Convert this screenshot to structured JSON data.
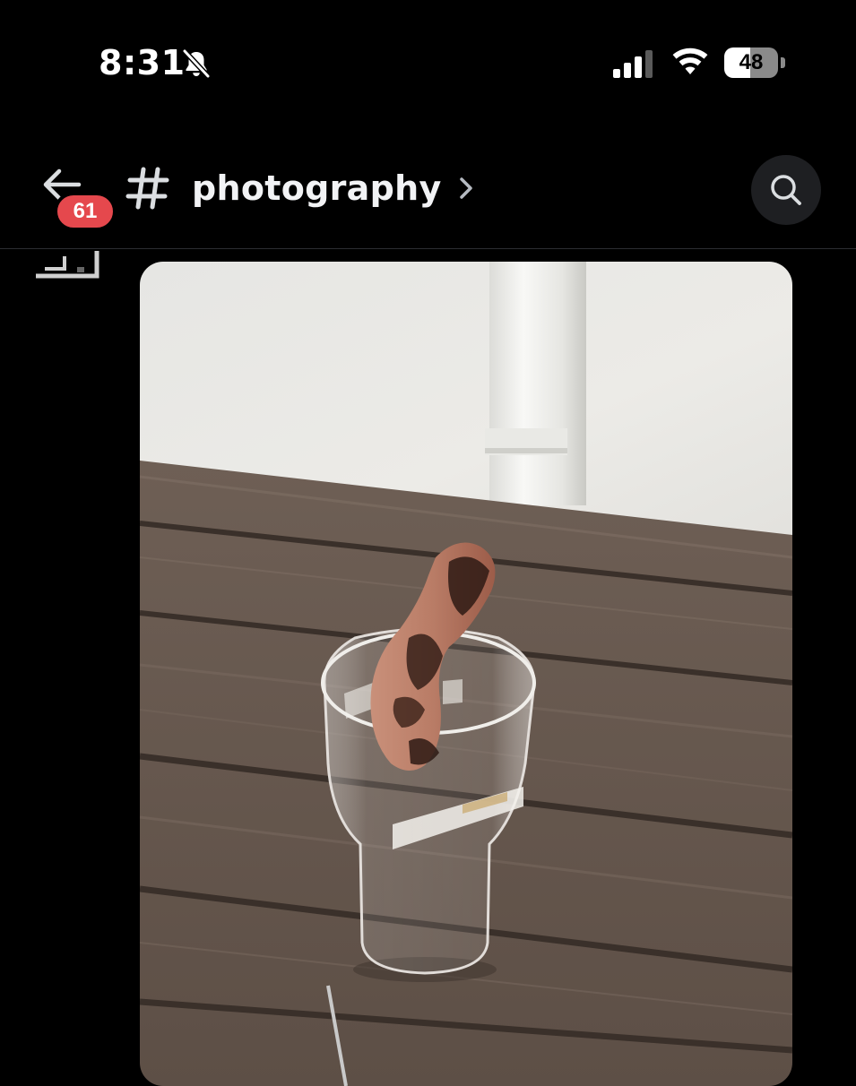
{
  "status_bar": {
    "time": "8:31",
    "battery_level": "48",
    "battery_fraction": 0.48,
    "signal_bars_active": 3,
    "signal_bars_total": 4,
    "icons": [
      "bell-slash-icon",
      "cellular-signal-icon",
      "wifi-icon",
      "battery-icon"
    ]
  },
  "header": {
    "back_icon": "arrow-left-icon",
    "unread_count": "61",
    "channel_icon": "hash-icon",
    "channel_name": "photography",
    "chevron_icon": "chevron-right-icon",
    "search_icon": "search-icon"
  },
  "message": {
    "reply_icon": "reply-connector-icon",
    "attachment_alt": "photo-attachment"
  },
  "colors": {
    "background": "#000000",
    "header_button_bg": "#1e1f22",
    "badge": "#e5484d",
    "text_primary": "#f2f3f5",
    "divider": "#2b2d31"
  }
}
